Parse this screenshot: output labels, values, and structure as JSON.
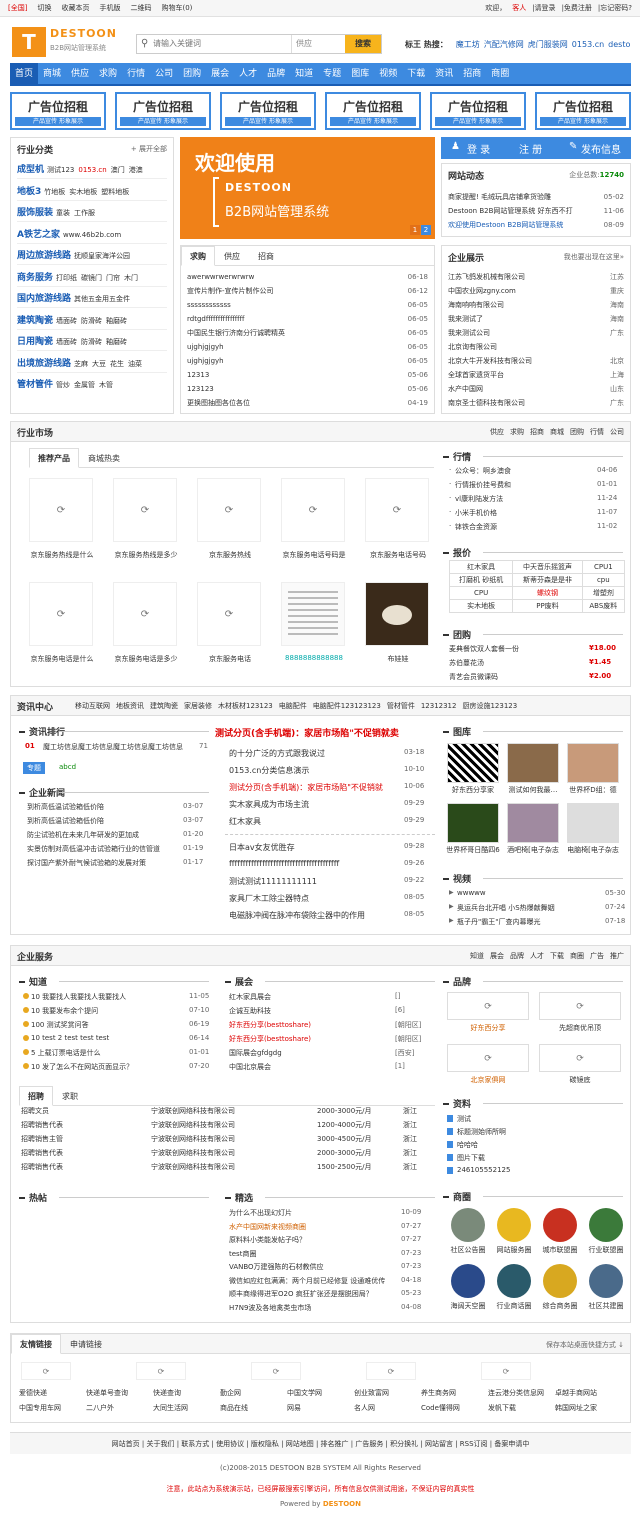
{
  "topbar": {
    "left": [
      "[全国]",
      "切换",
      "收藏本页",
      "手机版",
      "二维码",
      "购物车(0)"
    ],
    "right": [
      "欢迎，",
      "客人",
      "|请登录",
      "|免费注册",
      "|忘记密码?"
    ]
  },
  "header": {
    "logo_text": "DESTOON",
    "logo_sub": "B2B网站管理系统",
    "logo_mark": "T",
    "search_placeholder": "请输入关键词",
    "search_select": "供应",
    "search_btn": "搜索",
    "hot_label": "标王 热搜：",
    "hot": [
      "魔工坊",
      "汽配汽修网",
      "虎门服装网",
      "0153.cn",
      "desto"
    ]
  },
  "nav": [
    "首页",
    "商城",
    "供应",
    "求购",
    "行情",
    "公司",
    "团购",
    "展会",
    "人才",
    "品牌",
    "知道",
    "专题",
    "图库",
    "视频",
    "下载",
    "资讯",
    "招商",
    "商圈"
  ],
  "ads": {
    "title": "广告位招租",
    "sub": "产品宣传  形象展示"
  },
  "category": {
    "title": "行业分类",
    "more": "展开全部",
    "rows": [
      {
        "h": "成型机",
        "items": [
          "测试123",
          "0153.cn",
          "澳门",
          "港澳"
        ]
      },
      {
        "h": "地板3",
        "items": [
          "竹地板",
          "实木地板",
          "塑料地板"
        ]
      },
      {
        "h": "服饰服装",
        "items": [
          "童装",
          "工作服"
        ]
      },
      {
        "h": "A铁艺之家",
        "items": [
          "www.46b2b.com"
        ]
      },
      {
        "h": "周边旅游线路",
        "items": [
          "抚顺皇家海洋公园"
        ]
      },
      {
        "h": "商务服务",
        "items": [
          "打印纸",
          "碳镜门",
          "门帘",
          "木门"
        ]
      },
      {
        "h": "国内旅游线路",
        "items": [
          "其他五金用五金件"
        ]
      },
      {
        "h": "建筑陶瓷",
        "items": [
          "墙面砖",
          "防滑砖",
          "釉磨砖"
        ]
      },
      {
        "h": "日用陶瓷",
        "items": [
          "墙面砖",
          "防滑砖",
          "釉磨砖"
        ]
      },
      {
        "h": "出境旅游线路",
        "items": [
          "芝麻",
          "大豆",
          "花生",
          "油菜"
        ]
      },
      {
        "h": "管材管件",
        "items": [
          "管炒",
          "金属管",
          "木管"
        ]
      }
    ]
  },
  "banner": {
    "l1": "欢迎使用",
    "l2": "DESTOON",
    "l3": "B2B网站管理系统",
    "p1": "1",
    "p2": "2"
  },
  "buy": {
    "tabs": [
      "求购",
      "供应",
      "招商"
    ],
    "rows": [
      [
        "awerwwrwerwrwrw",
        "06-18"
      ],
      [
        "宣传片制作-宣传片制作公司",
        "06-12"
      ],
      [
        "ssssssssssss",
        "06-05"
      ],
      [
        "rdtgdffffffffffffffff",
        "06-05"
      ],
      [
        "中国民生银行济南分行诚聘精英",
        "06-05"
      ],
      [
        "ujghjgjgyh",
        "06-05"
      ],
      [
        "ujghjgjgyh",
        "06-05"
      ],
      [
        "12313",
        "05-06"
      ],
      [
        "123123",
        "05-06"
      ],
      [
        "更换图抽图各位各位",
        "04-19"
      ]
    ]
  },
  "login": {
    "login": "登 录",
    "reg": "注 册",
    "post": "发布信息"
  },
  "news": {
    "title": "网站动态",
    "meta": "企业总数:",
    "count": "12740",
    "rows": [
      [
        "商家提醒! 毛绒玩具店铺拿货验雕",
        "05-02"
      ],
      [
        "Destoon B2B网站管理系统 好东西不打",
        "11-06"
      ],
      [
        "欢迎使用Destoon B2B网站管理系统",
        "08-09"
      ]
    ]
  },
  "company": {
    "title": "企业展示",
    "more": "我也要出现在这里»",
    "rows": [
      [
        "江苏飞鸽发机械有限公司",
        "江苏"
      ],
      [
        "中国农业网zgny.com",
        "重庆"
      ],
      [
        "海南响响有限公司",
        "海南"
      ],
      [
        "我来测试了",
        "海南"
      ],
      [
        "我来测试公司",
        "广东"
      ],
      [
        "北京询有限公司",
        ""
      ],
      [
        "北京大牛开发科技有限公司",
        "北京"
      ],
      [
        "全球首家遗货平台",
        "上海"
      ],
      [
        "水产中国网",
        "山东"
      ],
      [
        "南京圣士德科技有限公司",
        "广东"
      ]
    ]
  },
  "market": {
    "title": "行业市场",
    "links": [
      "供应",
      "求购",
      "招商",
      "商城",
      "团购",
      "行情",
      "公司"
    ],
    "tabs": [
      "推荐产品",
      "商城热卖"
    ],
    "products": [
      "京东服务热线是什么",
      "京东服务热线是多少",
      "京东服务热线",
      "京东服务电话号码是",
      "京东服务电话号码",
      "京东服务电话是什么",
      "京东服务电话是多少",
      "京东服务电话",
      "8888888888888",
      "布娃娃"
    ]
  },
  "quote": {
    "title": "行情",
    "rows": [
      [
        "公众号：啊乡澳食",
        "04-06"
      ],
      [
        "行情报价挂号费和",
        "01-01"
      ],
      [
        "vl康利陆发方法",
        "11-24"
      ],
      [
        "小米手机价格",
        "11-07"
      ],
      [
        "钵铁合金资源",
        "11-02"
      ]
    ]
  },
  "price": {
    "title": "报价",
    "cells": [
      [
        "红木家具",
        "中天音乐摇篮声",
        "CPU1"
      ],
      [
        "打磨机 砂纸机",
        "斯蒂芬森是是非",
        "cpu"
      ],
      [
        "CPU",
        "螺纹钢",
        "增塑剂"
      ],
      [
        "实木地板",
        "PP废料",
        "ABS废料"
      ]
    ]
  },
  "group": {
    "title": "团购",
    "rows": [
      [
        "麦典餐饮双人套餐一份",
        "¥18.00"
      ],
      [
        "苏伯蔓花汤",
        "¥1.45"
      ],
      [
        "青艺会员微课码",
        "¥2.00"
      ]
    ]
  },
  "info": {
    "title": "资讯中心",
    "links": [
      "移动互联网",
      "地板资讯",
      "建筑陶瓷",
      "家居装修",
      "木材板材123123",
      "电脑配件",
      "电脑配件123123123",
      "管材管件",
      "12312312",
      "厨房设施123123"
    ],
    "rank_title": "资讯排行",
    "rank_no": "01",
    "rank_first": "魔工坊信息魔工坊信息魔工坊信息魔工坊信息",
    "rank_n": "71",
    "topic_label": "专题",
    "topic": "abcd",
    "ent_title": "企业新闻",
    "ent_rows": [
      [
        "到析高低温试验箱低价陪",
        "03-07"
      ],
      [
        "到析高低温试验箱低价陪",
        "03-07"
      ],
      [
        "防尘试验机在未来几年研发的更加成",
        "01-20"
      ],
      [
        "实景仿制对高低温冲击试验箱行业的信管道",
        "01-19"
      ],
      [
        "探讨国产紫外耐气候试验箱的发展对策",
        "01-17"
      ]
    ],
    "headline": "测试分页(含手机端)：家居市场陷\"不促销就卖",
    "rows1": [
      [
        "的十分广泛的方式跟我说过",
        "03-18"
      ],
      [
        "0153.cn分类信息演示",
        "10-10"
      ],
      [
        "测试分页(含手机端)：家居市场陷\"不促销就",
        "10-06"
      ],
      [
        "实木家具成为市场主流",
        "09-29"
      ],
      [
        "红木家具",
        "09-29"
      ]
    ],
    "rows2": [
      [
        "日本av女友优胜存",
        "09-28"
      ],
      [
        "ffffffffffffffffffffffffffffffffffffffff",
        "09-26"
      ],
      [
        "测试测试11111111111",
        "09-22"
      ],
      [
        "家具厂木工除尘器特点",
        "08-05"
      ],
      [
        "电磁脉冲阀在脉冲布袋除尘器中的作用",
        "08-05"
      ]
    ]
  },
  "gallery": {
    "title": "图库",
    "items": [
      "好东西分享家",
      "测试如何我最…",
      "世界杯D组：德",
      "世界杯哥日酷四6",
      "酒吧椅[电子杂志",
      "电脑椅[电子杂志"
    ]
  },
  "video": {
    "title": "视频",
    "rows": [
      [
        "wwwww",
        "05-30"
      ],
      [
        "奥运兵台北开唱 小S热爆献舞姻",
        "07-24"
      ],
      [
        "瓶子丹\"霸王\"厂查内幕曝光",
        "07-18"
      ]
    ]
  },
  "service": {
    "title": "企业服务",
    "links": [
      "知道",
      "展会",
      "品牌",
      "人才",
      "下载",
      "商圈",
      "广告",
      "推广"
    ],
    "know_title": "知道",
    "know": [
      [
        "10 我要找人我要找人我要找人",
        "11-05"
      ],
      [
        "10 我要发布余个提问",
        "07-10"
      ],
      [
        "100 测试奖赏问答",
        "06-19"
      ],
      [
        "10 test 2 test test test",
        "06-14"
      ],
      [
        "5 上载订票电话是什么",
        "01-01"
      ],
      [
        "10 发了怎么不在网站页面显示？",
        "07-20"
      ]
    ],
    "expo_title": "展会",
    "expo": [
      [
        "红木家具展会",
        "[]"
      ],
      [
        "企诚互助科技",
        "[6]"
      ],
      [
        "好东西分享(besttoshare)",
        "[朝阳区]"
      ],
      [
        "好东西分享(besttoshare)",
        "[朝阳区]"
      ],
      [
        "国际展会gfdgdg",
        "[西安]"
      ],
      [
        "中国北京展会",
        "[1]"
      ]
    ],
    "job_tabs": [
      "招聘",
      "求职"
    ],
    "jobs": [
      [
        "招聘文员",
        "宁波联创网络科技有限公司",
        "2000-3000元/月",
        "浙江"
      ],
      [
        "招聘销售代表",
        "宁波联创网络科技有限公司",
        "1200-4000元/月",
        "浙江"
      ],
      [
        "招聘销售主管",
        "宁波联创网络科技有限公司",
        "3000-4500元/月",
        "浙江"
      ],
      [
        "招聘销售代表",
        "宁波联创网络科技有限公司",
        "2000-3000元/月",
        "浙江"
      ],
      [
        "招聘销售代表",
        "宁波联创网络科技有限公司",
        "1500-2500元/月",
        "浙江"
      ]
    ],
    "hot_title": "热帖",
    "best_title": "精选",
    "best": [
      [
        "为什么不出现幻灯片",
        "10-09"
      ],
      [
        "水产中国网新来视频商圈",
        "07-27"
      ],
      [
        "原料料小类能发帖子吗？",
        "07-27"
      ],
      [
        "test商圈",
        "07-23"
      ],
      [
        "VANBO万建强陈的石材教供应",
        "07-23"
      ],
      [
        "微信如应红包满满：两个月前已经修复 设通难优传",
        "04-18"
      ],
      [
        "顺丰商缘得进军O2O 疯狂扩张还是摆脱困局？",
        "05-23"
      ],
      [
        "H7N9波及各地禽类虫市场",
        "04-08"
      ]
    ]
  },
  "brand": {
    "title": "品牌",
    "items": [
      "好东西分享",
      "先超商优吊顶",
      "北京家俱网",
      "碳镜底"
    ]
  },
  "doc": {
    "title": "资料",
    "items": [
      "测试",
      "标题测始师所啊",
      "哈哈哈",
      "图片下载",
      "246105552125"
    ]
  },
  "circle": {
    "title": "商圈",
    "items": [
      "社区公告圈",
      "网站服务圈",
      "城市联盟圈",
      "行业联盟圈",
      "海阔天空圈",
      "行业商话圈",
      "综合商务圈",
      "社区共建圈"
    ],
    "colors": [
      "#7a8a7a",
      "#e8b820",
      "#c83020",
      "#3b7a3a",
      "#2a4a8a",
      "#2a5a6a",
      "#d8a820",
      "#4a6a8a"
    ]
  },
  "friend": {
    "tabs": [
      "友情链接",
      "申请链接"
    ],
    "right": "保存本站桌面快捷方式 ↓",
    "links1": [
      "爱德快递",
      "快递单号查询",
      "快递查询",
      "勤企网",
      "中国文学网",
      "创业致富网",
      "养生商务网",
      "连云港分类信息网",
      "卓越手商网站"
    ],
    "links2": [
      "中国专用车网",
      "二八户外",
      "大同生活网",
      "商品在线",
      "网易",
      "名人网",
      "Code懂得网",
      "发帆下载",
      "韩国网址之家"
    ]
  },
  "footer": {
    "links": "网站首页 | 关于我们 | 联系方式 | 使用协议 | 版权隐私 | 网站地图 | 排名推广 | 广告服务 | 积分换礼 | 网站留言 | RSS订阅 | 备案申请中",
    "copy": "(c)2008-2015 DESTOON B2B SYSTEM All Rights Reserved",
    "notice": "注意，此站点为系统演示站，已经屏蔽搜索引擎访问，所有信息仅供测试用途，不保证内容的真实性",
    "powered": "Powered by",
    "pbrand": "DESTOON"
  }
}
